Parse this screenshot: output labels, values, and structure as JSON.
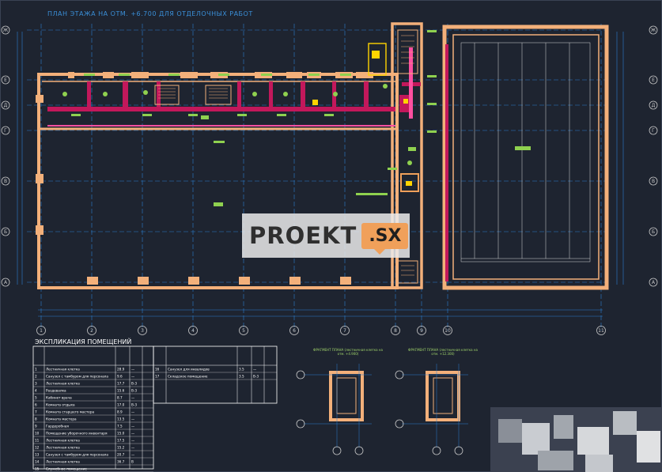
{
  "drawing": {
    "title": "ПЛАН ЭТАЖА НА ОТМ. +6.700 ДЛЯ ОТДЕЛОЧНЫХ РАБОТ",
    "row_axes": [
      "Ж",
      "Е",
      "Д",
      "Г",
      "В",
      "Б",
      "А"
    ],
    "column_axes": [
      "1",
      "2",
      "3",
      "4",
      "5",
      "6",
      "7",
      "8",
      "9",
      "10",
      "11"
    ],
    "colors": {
      "background": "#1e2430",
      "walls": "#f3b07a",
      "partitions": "#c2185b",
      "dimensions": "#2b7fd0",
      "labels": "#8fd14f",
      "accent": "#ffd400"
    }
  },
  "legend": {
    "title": "ЭКСПЛИКАЦИЯ ПОМЕЩЕНИЙ",
    "header_left": [
      "Номер помещения",
      "Наименование",
      "Площадь м²",
      "Кат. пом."
    ],
    "header_right": [
      "Номер помещения",
      "Наименование",
      "Площадь м²",
      "Кат. пом."
    ],
    "rows_left": [
      {
        "num": "1",
        "name": "Лестничная клетка",
        "area": "28.9",
        "cat": "—"
      },
      {
        "num": "2",
        "name": "Санузел с тамбуром для персонала",
        "area": "9.6",
        "cat": "—"
      },
      {
        "num": "3",
        "name": "Лестничная клетка",
        "area": "17.7",
        "cat": "В-3"
      },
      {
        "num": "4",
        "name": "Раздевалка",
        "area": "15.6",
        "cat": "В-3"
      },
      {
        "num": "5",
        "name": "Кабинет врача",
        "area": "8.7",
        "cat": "—"
      },
      {
        "num": "6",
        "name": "Комната отдыха",
        "area": "17.0",
        "cat": "В-3"
      },
      {
        "num": "7",
        "name": "Комната старшего мастера",
        "area": "8.9",
        "cat": "—"
      },
      {
        "num": "8",
        "name": "Комната мастера",
        "area": "13.5",
        "cat": "—"
      },
      {
        "num": "9",
        "name": "Гардеробная",
        "area": "7.5",
        "cat": "—"
      },
      {
        "num": "10",
        "name": "Помещение уборочного инвентаря",
        "area": "15.0",
        "cat": "—"
      },
      {
        "num": "11",
        "name": "Лестничная клетка",
        "area": "17.5",
        "cat": "—"
      },
      {
        "num": "12",
        "name": "Лестничная клетка",
        "area": "15.2",
        "cat": "—"
      },
      {
        "num": "13",
        "name": "Санузел с тамбуром для персонала",
        "area": "20.7",
        "cat": "—"
      },
      {
        "num": "14",
        "name": "Лестничная клетка",
        "area": "36.7",
        "cat": "В"
      },
      {
        "num": "15",
        "name": "Служебное помещение",
        "area": "—",
        "cat": "—"
      }
    ],
    "rows_right": [
      {
        "num": "16",
        "name": "Санузел для инвалидов",
        "area": "3.5",
        "cat": "—"
      },
      {
        "num": "17",
        "name": "Складское помещение",
        "area": "3.5",
        "cat": "В-3"
      }
    ]
  },
  "fragments": [
    {
      "title": "ФРАГМЕНТ ПЛАНА (лестничная клетка на отм. +4.900)",
      "axes": [
        "8",
        "9"
      ],
      "rows": [
        "Ж",
        "Е"
      ]
    },
    {
      "title": "ФРАГМЕНТ ПЛАНА (лестничная клетка на отм. +12.300)",
      "axes": [
        "8",
        "9"
      ],
      "rows": [
        "Ж",
        "Е"
      ]
    }
  ],
  "watermark": {
    "brand": "PROEKT",
    "suffix": ".SX"
  }
}
